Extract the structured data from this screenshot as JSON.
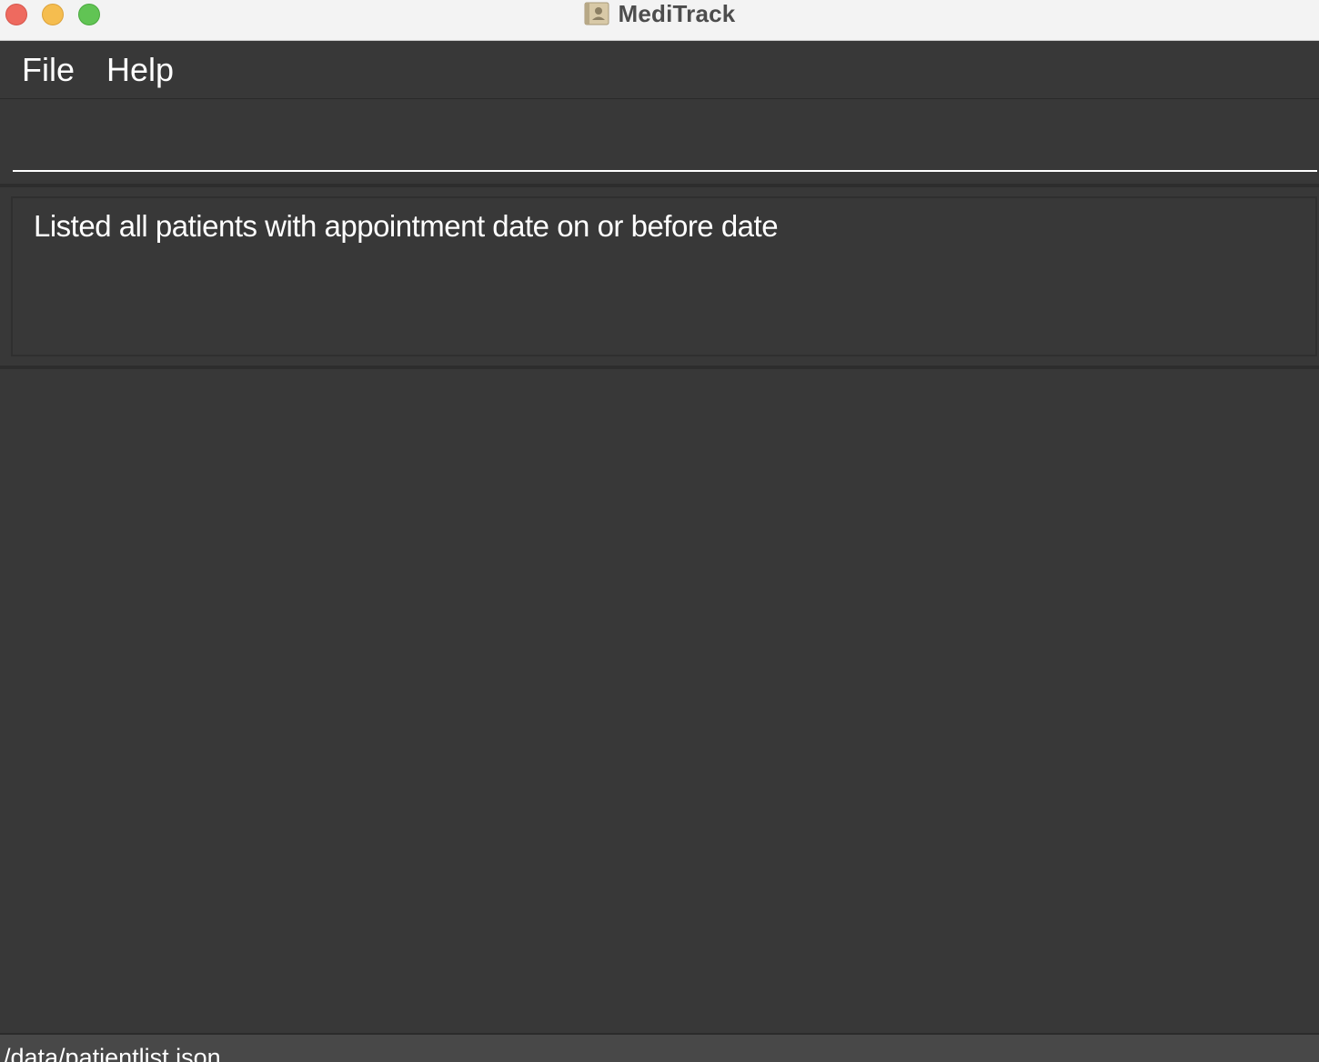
{
  "window": {
    "title": "MediTrack",
    "app_icon": "address-book-icon"
  },
  "menu": {
    "items": [
      "File",
      "Help"
    ]
  },
  "command_box": {
    "value": "",
    "placeholder": ""
  },
  "result_display": {
    "message": "Listed all patients with appointment date on or before date"
  },
  "patient_list": {
    "items": []
  },
  "status_bar": {
    "file_path": "/data/patientlist.json"
  }
}
